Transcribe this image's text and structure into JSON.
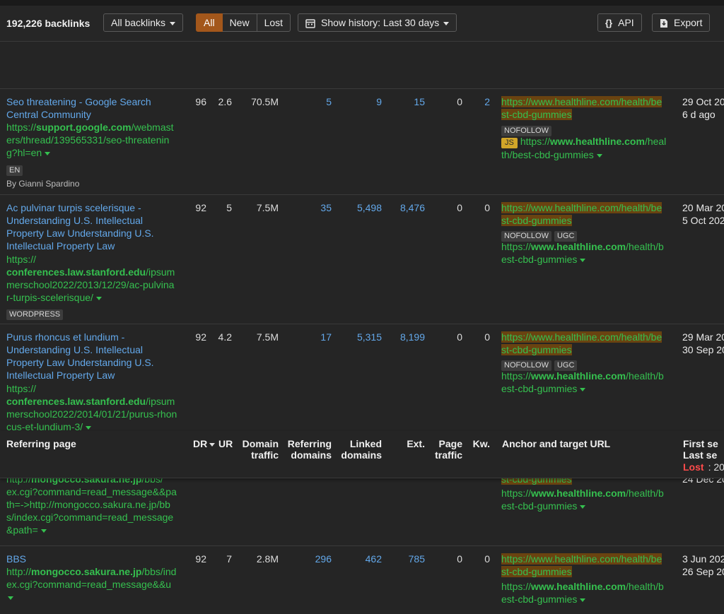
{
  "toolbar": {
    "count": "192,226 backlinks",
    "filter_label": "All backlinks",
    "seg_all": "All",
    "seg_new": "New",
    "seg_lost": "Lost",
    "history_label": "Show history: Last 30 days",
    "api_label": "API",
    "export_label": "Export"
  },
  "columns": {
    "referring_page": "Referring page",
    "dr": "DR",
    "ur": "UR",
    "domain_traffic_1": "Domain",
    "domain_traffic_2": "traffic",
    "ref_domains_1": "Referring",
    "ref_domains_2": "domains",
    "linked_domains_1": "Linked",
    "linked_domains_2": "domains",
    "ext": "Ext.",
    "page_traffic_1": "Page",
    "page_traffic_2": "traffic",
    "kw": "Kw.",
    "anchor": "Anchor and target URL",
    "first_seen": "First se",
    "last_seen": "Last se",
    "lost": "Lost",
    "lost_date": ": 20"
  },
  "rows": [
    {
      "title": [
        "Seo threatening - Google Search",
        "Central Community"
      ],
      "url_pre": "https://",
      "url_domain": "support.google.com",
      "url_lines": [
        "/webmast",
        "ers/thread/139565331/seo-threatenin",
        "g?hl=en"
      ],
      "lang": "EN",
      "author": "By Gianni Spardino",
      "dr": "96",
      "ur": "2.6",
      "traffic": "70.5M",
      "ref_domains": "5",
      "linked_domains": "9",
      "ext": "15",
      "page_traffic": "0",
      "kw": "2",
      "anchor_lines": [
        "https://www.healthline.com/health/be",
        "st-cbd-gummies"
      ],
      "badges": [
        "NOFOLLOW"
      ],
      "js": "JS",
      "target_pre": "https://",
      "target_domain": "www.healthline.com",
      "target_lines": [
        "/heal",
        "th/best-cbd-gummies"
      ],
      "first": "29 Oct 20",
      "last": "6 d ago"
    },
    {
      "title": [
        "Ac pulvinar turpis scelerisque -",
        "Understanding U.S. Intellectual",
        "Property Law Understanding U.S.",
        "Intellectual Property Law"
      ],
      "url_pre": "https://",
      "url_domain": "conferences.law.stanford.edu",
      "url_lines": [
        "/ipsum",
        "merschool2022/2013/12/29/ac-pulvina",
        "r-turpis-scelerisque/"
      ],
      "lang": "WORDPRESS",
      "dr": "92",
      "ur": "5",
      "traffic": "7.5M",
      "ref_domains": "35",
      "linked_domains": "5,498",
      "ext": "8,476",
      "page_traffic": "0",
      "kw": "0",
      "anchor_lines": [
        "https://www.healthline.com/health/be",
        "st-cbd-gummies"
      ],
      "badges": [
        "NOFOLLOW",
        "UGC"
      ],
      "target_pre": "https://",
      "target_domain": "www.healthline.com",
      "target_lines": [
        "/health/b",
        "est-cbd-gummies"
      ],
      "first": "20 Mar 20",
      "last": "5 Oct 202"
    },
    {
      "title": [
        "Purus rhoncus et lundium -",
        "Understanding U.S. Intellectual",
        "Property Law Understanding U.S.",
        "Intellectual Property Law"
      ],
      "url_pre": "https://",
      "url_domain": "conferences.law.stanford.edu",
      "url_lines": [
        "/ipsum",
        "merschool2022/2014/01/21/purus-rhon",
        "cus-et-lundium-3/"
      ],
      "dr": "92",
      "ur": "4.2",
      "traffic": "7.5M",
      "ref_domains": "17",
      "linked_domains": "5,315",
      "ext": "8,199",
      "page_traffic": "0",
      "kw": "0",
      "anchor_lines": [
        "https://www.healthline.com/health/be",
        "st-cbd-gummies"
      ],
      "badges": [
        "NOFOLLOW",
        "UGC"
      ],
      "target_pre": "https://",
      "target_domain": "www.healthline.com",
      "target_lines": [
        "/health/b",
        "est-cbd-gummies"
      ],
      "first": "29 Mar 20",
      "last": "30 Sep 20"
    },
    {
      "url_partial_pre": "http://",
      "url_partial_domain": "mongocco.sakura.ne.jp",
      "url_partial_rest": "/bbs/",
      "url_lines": [
        "ex.cgi?command=read_message&&pa",
        "th=->http://mongocco.sakura.ne.jp/bb",
        "s/index.cgi?command=read_message",
        "&path="
      ],
      "anchor_partial": "st-cbd-gummies",
      "target_pre": "https://",
      "target_domain": "www.healthline.com",
      "target_lines": [
        "/health/b",
        "est-cbd-gummies"
      ],
      "last": "24 Dec 20"
    },
    {
      "title": [
        "BBS"
      ],
      "url_pre": "http://",
      "url_domain": "mongocco.sakura.ne.jp",
      "url_lines": [
        "/bbs/ind",
        "ex.cgi?command=read_message&&u"
      ],
      "dr": "92",
      "ur": "7",
      "traffic": "2.8M",
      "ref_domains": "296",
      "linked_domains": "462",
      "ext": "785",
      "page_traffic": "0",
      "kw": "0",
      "anchor_lines": [
        "https://www.healthline.com/health/be",
        "st-cbd-gummies"
      ],
      "target_pre": "https://",
      "target_domain": "www.healthline.com",
      "target_lines": [
        "/health/b",
        "est-cbd-gummies"
      ],
      "first": "3 Jun 202",
      "last": "26 Sep 20"
    }
  ]
}
